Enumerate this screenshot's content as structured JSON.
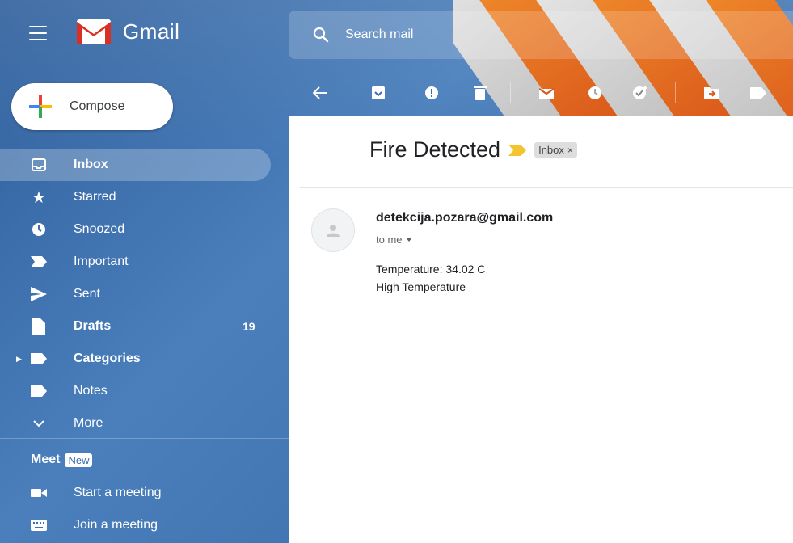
{
  "app": {
    "name": "Gmail"
  },
  "search": {
    "placeholder": "Search mail"
  },
  "compose": {
    "label": "Compose"
  },
  "sidebar": {
    "items": [
      {
        "label": "Inbox",
        "icon": "inbox-icon",
        "active": true,
        "bold": true
      },
      {
        "label": "Starred",
        "icon": "star-icon"
      },
      {
        "label": "Snoozed",
        "icon": "clock-icon"
      },
      {
        "label": "Important",
        "icon": "important-icon"
      },
      {
        "label": "Sent",
        "icon": "send-icon"
      },
      {
        "label": "Drafts",
        "icon": "draft-icon",
        "bold": true,
        "count": "19"
      },
      {
        "label": "Categories",
        "icon": "label-icon",
        "bold": true
      },
      {
        "label": "Notes",
        "icon": "label-icon"
      },
      {
        "label": "More",
        "icon": "chevron-down-icon"
      }
    ]
  },
  "meet": {
    "title": "Meet",
    "badge": "New",
    "items": [
      {
        "label": "Start a meeting",
        "icon": "video-icon"
      },
      {
        "label": "Join a meeting",
        "icon": "keyboard-icon"
      }
    ]
  },
  "email": {
    "subject": "Fire Detected",
    "label": "Inbox",
    "label_close": "×",
    "sender": "detekcija.pozara@gmail.com",
    "to": "to me",
    "body": [
      "Temperature: 34.02 C",
      "High Temperature"
    ]
  },
  "colors": {
    "theme_blue": "#3b6fae",
    "important_yellow": "#f4c430",
    "gmail_red": "#d93025"
  }
}
